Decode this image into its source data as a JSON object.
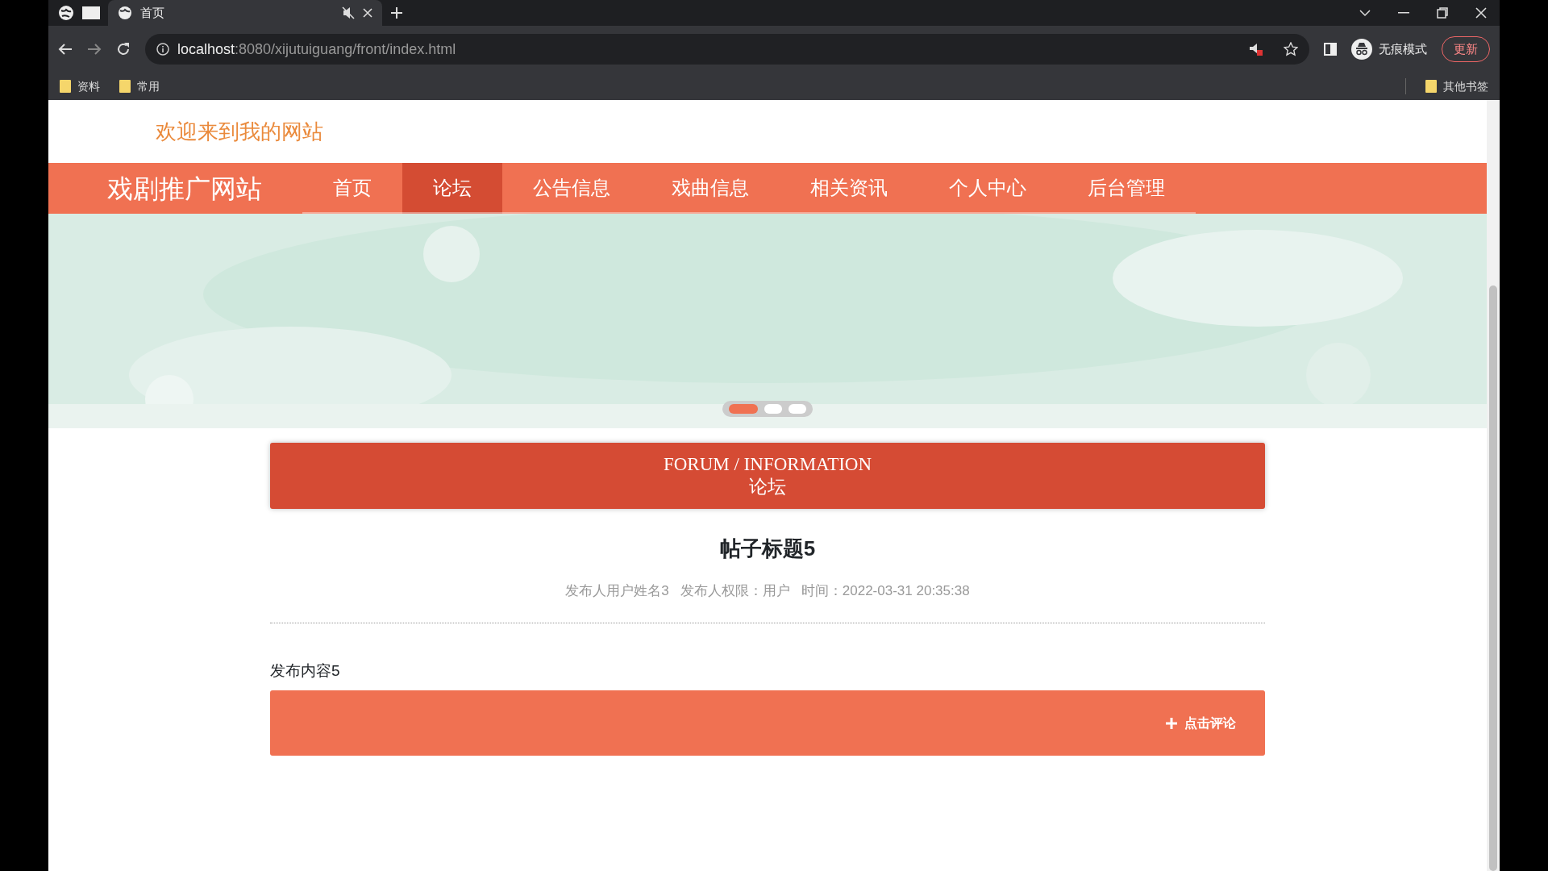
{
  "browser": {
    "tabs": [
      {
        "title": "首页",
        "muted": true,
        "selected": true
      }
    ],
    "url_host": "localhost",
    "url_path": ":8080/xijutuiguang/front/index.html",
    "bookmarks": [
      "资料",
      "常用"
    ],
    "other_bookmarks": "其他书签",
    "incognito_label": "无痕模式",
    "update_label": "更新"
  },
  "site": {
    "welcome": "欢迎来到我的网站",
    "brand": "戏剧推广网站",
    "nav": [
      {
        "label": "首页",
        "selected": false
      },
      {
        "label": "论坛",
        "selected": true
      },
      {
        "label": "公告信息",
        "selected": false
      },
      {
        "label": "戏曲信息",
        "selected": false
      },
      {
        "label": "相关资讯",
        "selected": false
      },
      {
        "label": "个人中心",
        "selected": false
      },
      {
        "label": "后台管理",
        "selected": false
      }
    ]
  },
  "banner": {
    "dots": [
      {
        "selected": true
      },
      {
        "selected": false
      },
      {
        "selected": false
      }
    ]
  },
  "section": {
    "title_en": "FORUM / INFORMATION",
    "title_zh": "论坛"
  },
  "post": {
    "title": "帖子标题5",
    "author": "发布人用户姓名3",
    "role": "发布人权限：用户",
    "time": "时间：2022-03-31 20:35:38",
    "content": "发布内容5"
  },
  "comment_button": {
    "label": "点击评论"
  }
}
